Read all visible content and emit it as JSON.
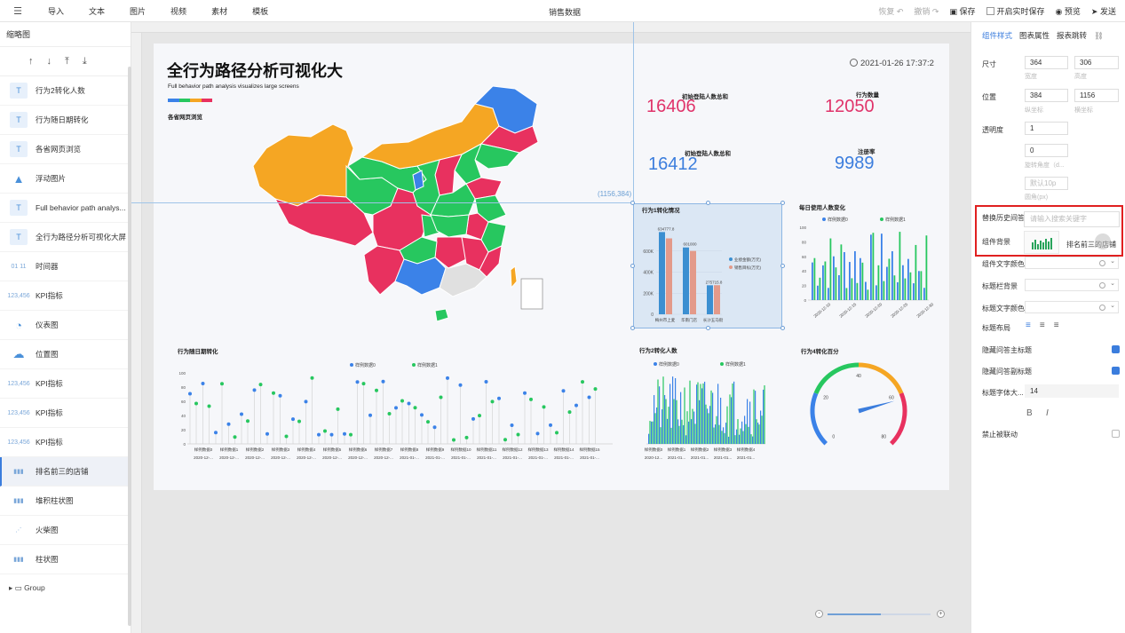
{
  "topbar": {
    "menu": [
      "导入",
      "文本",
      "图片",
      "视频",
      "素材",
      "模板"
    ],
    "title": "销售数据",
    "undo": "恢复",
    "redo": "撤销",
    "save": "保存",
    "autosave": "开启实时保存",
    "preview": "预览",
    "publish": "发送"
  },
  "left_panel": {
    "title": "缩略图",
    "layers": [
      {
        "label": "行为2转化人数",
        "icon": "text-icon"
      },
      {
        "label": "行为随日期转化",
        "icon": "text-icon"
      },
      {
        "label": "各省网页浏览",
        "icon": "text-icon"
      },
      {
        "label": "浮动图片",
        "icon": "image-icon"
      },
      {
        "label": "Full behavior path analys...",
        "icon": "text-icon"
      },
      {
        "label": "全行为路径分析可视化大屏",
        "icon": "text-icon"
      },
      {
        "label": "时间器",
        "icon": "timer-icon"
      },
      {
        "label": "KPI指标",
        "icon": "kpi-icon"
      },
      {
        "label": "仪表图",
        "icon": "gauge-icon"
      },
      {
        "label": "位置图",
        "icon": "map-icon"
      },
      {
        "label": "KPI指标",
        "icon": "kpi-icon"
      },
      {
        "label": "KPI指标",
        "icon": "kpi-icon"
      },
      {
        "label": "KPI指标",
        "icon": "kpi-icon"
      },
      {
        "label": "排名前三的店铺",
        "icon": "bar-chart-icon",
        "selected": true
      },
      {
        "label": "堆积柱状图",
        "icon": "bar-chart-icon"
      },
      {
        "label": "火柴图",
        "icon": "scatter-icon"
      },
      {
        "label": "柱状图",
        "icon": "bar-chart-icon"
      }
    ],
    "group": "Group"
  },
  "canvas": {
    "coord_label": "(1156,384)",
    "title": "全行为路径分析可视化大",
    "subtitle": "Full behavior path analysis visualizes large screens",
    "map_title": "各省网页浏览",
    "datetime": "2021-01-26 17:37:2",
    "kpis": [
      {
        "label": "初始登陆人数总和",
        "value": "16406",
        "color": "#e0336a"
      },
      {
        "label": "行为数量",
        "value": "12050",
        "color": "#e0336a"
      },
      {
        "label": "初始登陆人数总和",
        "value": "16412",
        "color": "#3b7ddd"
      },
      {
        "label": "注册率",
        "value": "9989",
        "color": "#3b7ddd"
      }
    ]
  },
  "chart_data": [
    {
      "type": "bar",
      "title": "行为1转化情况",
      "categories": [
        "梅州市上麦",
        "华南门店",
        "长沙五马街"
      ],
      "series": [
        {
          "name": "业绩金额(万元)",
          "values": [
            780,
            634,
            275
          ]
        },
        {
          "name": "销售目标(万元)",
          "values": [
            720,
            601,
            276
          ]
        }
      ],
      "data_labels": [
        "634777.8",
        "601000",
        "275715.8"
      ],
      "y_ticks": [
        "0",
        "200K",
        "400K",
        "600K"
      ]
    },
    {
      "type": "bar",
      "title": "每日使用人数变化",
      "series": [
        {
          "name": "样例数据0"
        },
        {
          "name": "样例数据1"
        }
      ],
      "x_ticks": [
        "2020-12-10",
        "2020-12-15",
        "2020-12-20",
        "2020-12-25",
        "2020-12-30"
      ],
      "y_ticks": [
        "0",
        "20",
        "40",
        "60",
        "80",
        "100"
      ]
    },
    {
      "type": "scatter",
      "title": "行为随日期转化",
      "series": [
        {
          "name": "样例数据0"
        },
        {
          "name": "样例数据1"
        }
      ],
      "x_ticks": [
        "2020-12-...",
        "2020-12-...",
        "2020-12-...",
        "2020-12-...",
        "2020-12-...",
        "2020-12-...",
        "2020-12-...",
        "2020-12-...",
        "2021-01-...",
        "2021-01-...",
        "2021-01-...",
        "2021-01-...",
        "2021-01-...",
        "2021-01-...",
        "2021-01-...",
        "2021-01-..."
      ],
      "y_ticks": [
        "0",
        "20",
        "40",
        "60",
        "80",
        "100"
      ]
    },
    {
      "type": "bar",
      "title": "行为2转化人数",
      "series": [
        {
          "name": "样例数据0"
        },
        {
          "name": "样例数据1"
        }
      ],
      "x_ticks": [
        "2020-12...",
        "2021-01...",
        "2021-01...",
        "2021-01...",
        "2021-01..."
      ]
    },
    {
      "type": "gauge",
      "title": "行为4转化百分",
      "ticks": [
        "0",
        "20",
        "40",
        "60",
        "80"
      ],
      "value": 62
    }
  ],
  "right_panel": {
    "tabs": [
      "组件样式",
      "图表属性",
      "报表跳转"
    ],
    "size_label": "尺寸",
    "width": "364",
    "height": "306",
    "width_hint": "宽度",
    "height_hint": "高度",
    "position_label": "位置",
    "pos_x": "384",
    "pos_y": "1156",
    "x_hint": "纵坐标",
    "y_hint": "横坐标",
    "opacity_label": "透明度",
    "opacity": "1",
    "rotate": "0",
    "rotate_hint": "旋转角度（d...",
    "radius_placeholder": "默认10p",
    "radius_hint": "圆角(px)",
    "replace_label": "替换历史间答",
    "search_placeholder": "请输入搜索关键字",
    "component_bg_label": "组件背景",
    "suggestion": "排名前三的店铺",
    "text_color_label": "组件文字颜色",
    "title_bg_label": "标题栏背景",
    "title_text_color_label": "标题文字颜色",
    "title_layout_label": "标题布局",
    "hide_main_title_label": "隐藏问答主标题",
    "hide_sub_title_label": "隐藏问答副标题",
    "title_font_size_label": "标题字体大...",
    "title_font_size": "14",
    "disable_link_label": "禁止被联动",
    "bold_label": "B",
    "italic_label": "I"
  },
  "colors": {
    "accent": "#3b7ddd",
    "map_orange": "#f5a623",
    "map_red": "#e8315f",
    "map_green": "#27c75f",
    "map_blue": "#3b82e8",
    "bar_blue": "#3b8fd1",
    "bar_salmon": "#e39a8a"
  }
}
